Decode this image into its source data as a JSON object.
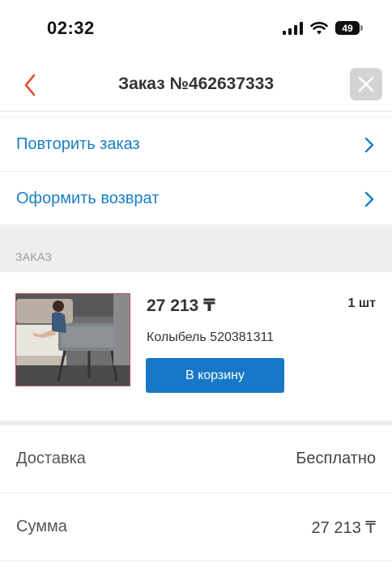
{
  "status_bar": {
    "time": "02:32",
    "battery": "49",
    "icons": [
      "signal-icon",
      "wifi-icon",
      "battery-icon"
    ]
  },
  "nav": {
    "title": "Заказ №462637333",
    "back_icon": "chevron-left-icon",
    "close_icon": "close-icon"
  },
  "actions": [
    {
      "label": "Повторить заказ",
      "icon": "chevron-right-icon"
    },
    {
      "label": "Оформить возврат",
      "icon": "chevron-right-icon"
    }
  ],
  "section": {
    "title": "ЗАКАЗ"
  },
  "product": {
    "price": "27 213 ₸",
    "quantity": "1 шт",
    "name": "Колыбель 520381311",
    "add_to_cart_label": "В корзину"
  },
  "summary": {
    "delivery_label": "Доставка",
    "delivery_value": "Бесплатно",
    "total_label": "Сумма",
    "total_value": "27 213 ₸"
  },
  "colors": {
    "accent": "#1a7fc4",
    "button": "#1678c7",
    "back_arrow": "#e0503c",
    "section_bg": "#efefef"
  }
}
